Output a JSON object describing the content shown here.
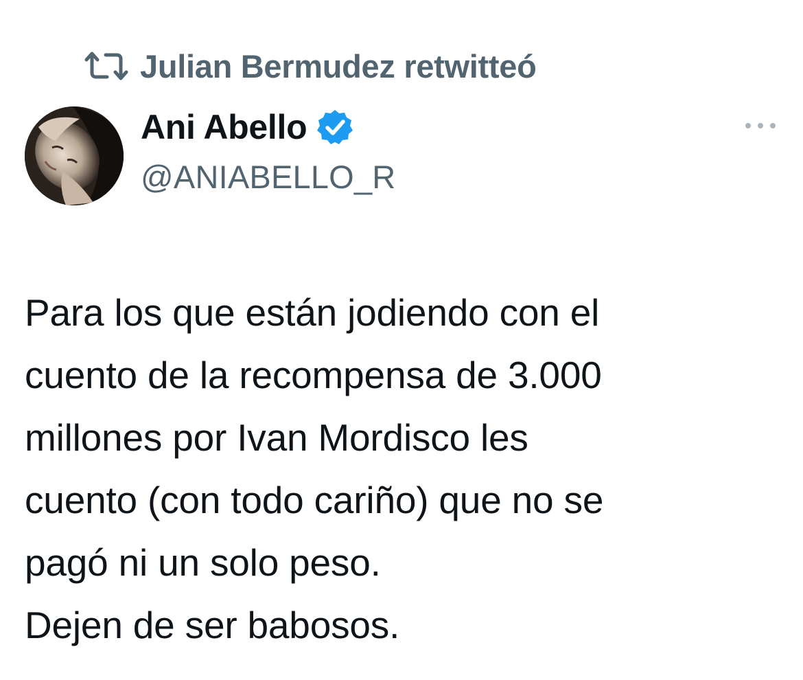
{
  "retweet": {
    "icon": "retweet-icon",
    "text": "Julian Bermudez retwitteó"
  },
  "author": {
    "avatar": "avatar",
    "name": "Ani Abello",
    "verified_icon": "verified-badge-icon",
    "handle": "@ANIABELLO_R"
  },
  "more_icon": "more-options-icon",
  "tweet": {
    "lines": [
      "Para los que están jodiendo con el",
      "cuento de la recompensa de 3.000",
      "millones por Ivan Mordisco les",
      "cuento (con todo cariño) que no se",
      "pagó ni un solo peso.",
      "Dejen de ser babosos."
    ]
  },
  "colors": {
    "text_primary": "#0f1419",
    "text_secondary": "#536471",
    "verified_blue": "#1d9bf0",
    "background": "#ffffff"
  }
}
